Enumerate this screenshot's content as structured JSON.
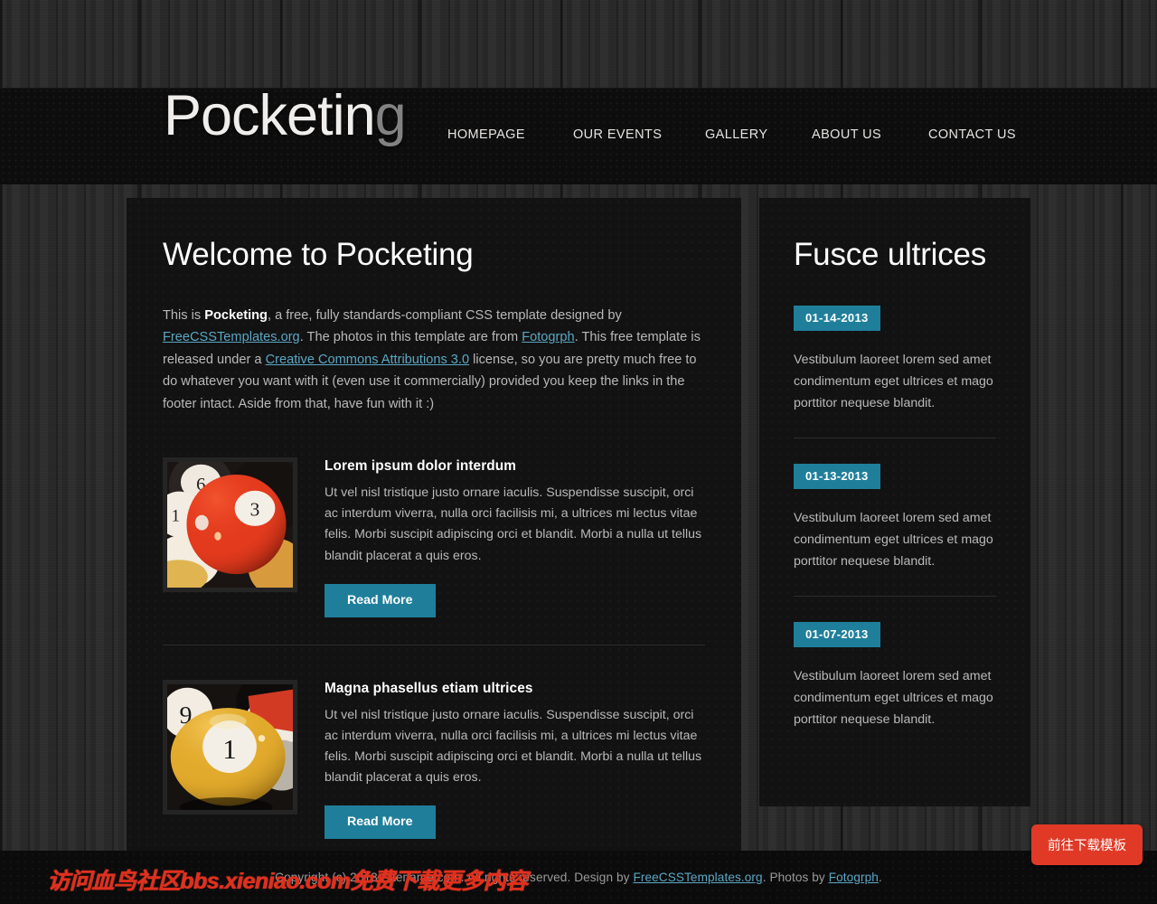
{
  "site": {
    "logo_main": "Pocketin",
    "logo_tail": "g"
  },
  "nav": {
    "items": [
      {
        "label": "HOMEPAGE"
      },
      {
        "label": "OUR EVENTS"
      },
      {
        "label": "GALLERY"
      },
      {
        "label": "ABOUT US"
      },
      {
        "label": "CONTACT US"
      }
    ]
  },
  "content": {
    "title": "Welcome to Pocketing",
    "intro": {
      "p1_a": "This is ",
      "p1_b": "Pocketing",
      "p1_c": ", a free, fully standards-compliant CSS template designed by ",
      "link1": "FreeCSSTemplates.org",
      "p1_d": ". The photos in this template are from ",
      "link2": "Fotogrph",
      "p1_e": ". This free template is released under a ",
      "link3": "Creative Commons Attributions 3.0",
      "p1_f": " license, so you are pretty much free to do whatever you want with it (even use it commercially) provided you keep the links in the footer intact. Aside from that, have fun with it :)"
    },
    "articles": [
      {
        "heading": "Lorem ipsum dolor interdum",
        "body": "Ut vel nisl tristique justo ornare iaculis. Suspendisse suscipit, orci ac interdum viverra, nulla orci facilisis mi, a ultrices mi lectus vitae felis. Morbi suscipit adipiscing orci et blandit. Morbi a nulla ut tellus blandit placerat a quis eros.",
        "button": "Read More",
        "image_alt": "pool-balls-red-three"
      },
      {
        "heading": "Magna phasellus etiam ultrices",
        "body": "Ut vel nisl tristique justo ornare iaculis. Suspendisse suscipit, orci ac interdum viverra, nulla orci facilisis mi, a ultrices mi lectus vitae felis. Morbi suscipit adipiscing orci et blandit. Morbi a nulla ut tellus blandit placerat a quis eros.",
        "button": "Read More",
        "image_alt": "pool-balls-yellow-one"
      }
    ]
  },
  "sidebar": {
    "title": "Fusce ultrices",
    "posts": [
      {
        "date": "01-14-2013",
        "body": "Vestibulum laoreet lorem sed amet condimentum eget ultrices et mago porttitor nequese blandit."
      },
      {
        "date": "01-13-2013",
        "body": "Vestibulum laoreet lorem sed amet condimentum eget ultrices et mago porttitor nequese blandit."
      },
      {
        "date": "01-07-2013",
        "body": "Vestibulum laoreet lorem sed amet condimentum eget ultrices et mago porttitor nequese blandit."
      }
    ]
  },
  "footer": {
    "copyright_prefix": "Copyright (c) 2013 Sitename.com. All rights reserved. Design by ",
    "link_design": "FreeCSSTemplates.org",
    "mid": ". Photos by ",
    "link_photos": "Fotogrph",
    "suffix": "."
  },
  "overlay": {
    "watermark": "访问血鸟社区bbs.xieniao.com免费下载更多内容",
    "download_button": "前往下载模板"
  },
  "colors": {
    "accent_teal": "#1f7f9b",
    "link_blue": "#5ba7c4",
    "panel_bg": "#121212",
    "header_bg": "#0d0d0d",
    "page_bg": "#2b2b2b",
    "watermark_red": "#e0301e",
    "download_red": "#e03a27"
  }
}
